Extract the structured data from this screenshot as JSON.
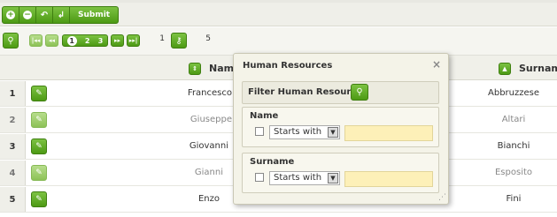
{
  "toolbar": {
    "buttons": [
      {
        "icon": "add-icon",
        "glyph": "+"
      },
      {
        "icon": "remove-icon",
        "glyph": "−"
      },
      {
        "icon": "undo-icon",
        "glyph": "↶"
      },
      {
        "icon": "return-icon",
        "glyph": "↲"
      }
    ],
    "submit_label": "Submit"
  },
  "pager": {
    "first_glyph": "|◂◂",
    "prev_glyph": "◂◂",
    "next_glyph": "▸▸",
    "last_glyph": "▸▸|",
    "pages": [
      "1",
      "2",
      "3"
    ],
    "current_page": "1",
    "page_value": "1",
    "page_size_value": "5"
  },
  "grid": {
    "columns": {
      "name": "Name",
      "surname": "Surname"
    },
    "rows": [
      {
        "num": "1",
        "name": "Francesco",
        "surname": "Abbruzzese"
      },
      {
        "num": "2",
        "name": "Giuseppe",
        "surname": "Altari"
      },
      {
        "num": "3",
        "name": "Giovanni",
        "surname": "Bianchi"
      },
      {
        "num": "4",
        "name": "Gianni",
        "surname": "Esposito"
      },
      {
        "num": "5",
        "name": "Enzo",
        "surname": "Fini"
      }
    ]
  },
  "dialog": {
    "title": "Human Resources",
    "close_glyph": "×",
    "filter_label": "Filter Human Resources",
    "fields": [
      {
        "label": "Name",
        "operator": "Starts with"
      },
      {
        "label": "Surname",
        "operator": "Starts with"
      }
    ]
  },
  "colors": {
    "accent_green": "#5aa71d",
    "input_highlight": "#fdf0b8"
  }
}
